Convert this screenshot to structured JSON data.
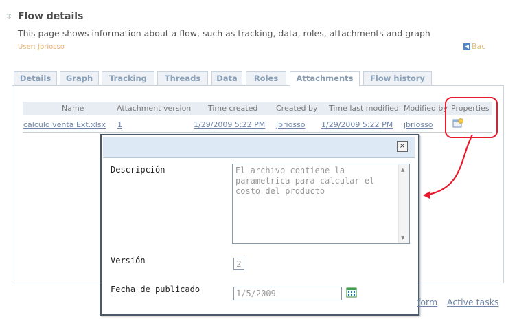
{
  "header": {
    "title": "Flow details",
    "subtitle": "This page shows information about a flow, such as tracking, data, roles, attachments and graph",
    "user_line": "User: jbriosso",
    "back_label": "Bac"
  },
  "tabs": [
    "Details",
    "Graph",
    "Tracking",
    "Threads",
    "Data",
    "Roles",
    "Attachments",
    "Flow history"
  ],
  "active_tab": "Attachments",
  "table": {
    "columns": [
      "Name",
      "Attachment version",
      "Time created",
      "Created by",
      "Time last modified",
      "Modified by",
      "Properties"
    ],
    "rows": [
      {
        "name": "calculo venta Ext.xlsx",
        "version": "1",
        "time_created": "1/29/2009 5:22 PM",
        "created_by": "jbriosso",
        "time_last_modified": "1/29/2009 5:22 PM",
        "modified_by": "jbriosso",
        "properties_icon": "properties-icon"
      }
    ]
  },
  "dialog": {
    "close_label": "×",
    "description_label": "Descripción",
    "description_value": "El archivo contiene la parametrica para calcular el costo del producto",
    "version_label": "Versión",
    "version_value": "2",
    "date_label": "Fecha de publicado",
    "date_value": "1/5/2009"
  },
  "footer_links": {
    "form_partial": "form",
    "active_tasks": "Active tasks"
  },
  "colors": {
    "highlight": "#e8192b",
    "link": "#6f86a8",
    "titlebar": "#dde9f5"
  }
}
